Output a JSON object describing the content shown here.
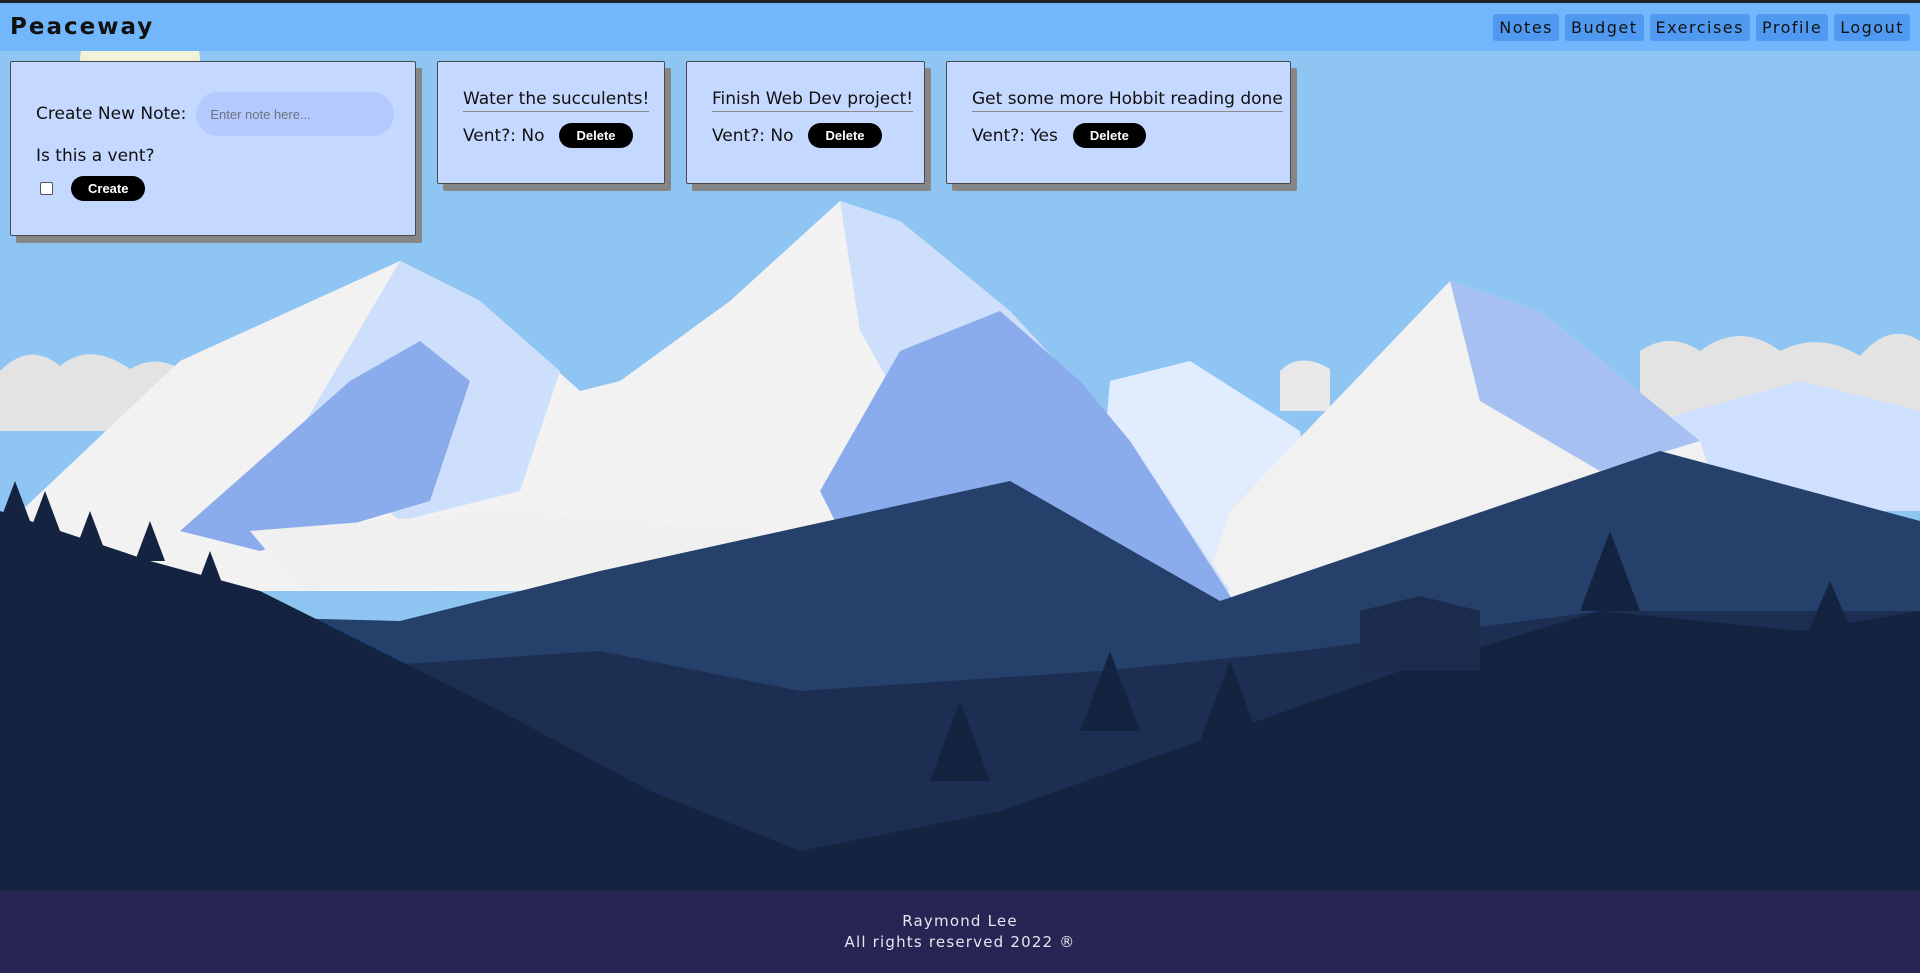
{
  "app": {
    "brand": "Peaceway"
  },
  "nav": {
    "items": [
      {
        "label": "Notes"
      },
      {
        "label": "Budget"
      },
      {
        "label": "Exercises"
      },
      {
        "label": "Profile"
      },
      {
        "label": "Logout"
      }
    ]
  },
  "create_form": {
    "label": "Create New Note:",
    "input_placeholder": "Enter note here...",
    "input_value": "",
    "vent_question": "Is this a vent?",
    "vent_checked": false,
    "create_label": "Create"
  },
  "notes": [
    {
      "title": "Water the succulents!",
      "vent": "Vent?: No",
      "delete_label": "Delete"
    },
    {
      "title": "Finish Web Dev project!",
      "vent": "Vent?: No",
      "delete_label": "Delete"
    },
    {
      "title": "Get some more Hobbit reading done",
      "vent": "Vent?: Yes",
      "delete_label": "Delete"
    }
  ],
  "footer": {
    "author": "Raymond Lee",
    "rights": "All rights reserved 2022 ®"
  },
  "colors": {
    "navbar": "#72b6fb",
    "nav_button": "#4f9af0",
    "card": "#c5d8ff",
    "sky": "#8fc5f3",
    "footer": "#282454",
    "button": "#000000"
  }
}
